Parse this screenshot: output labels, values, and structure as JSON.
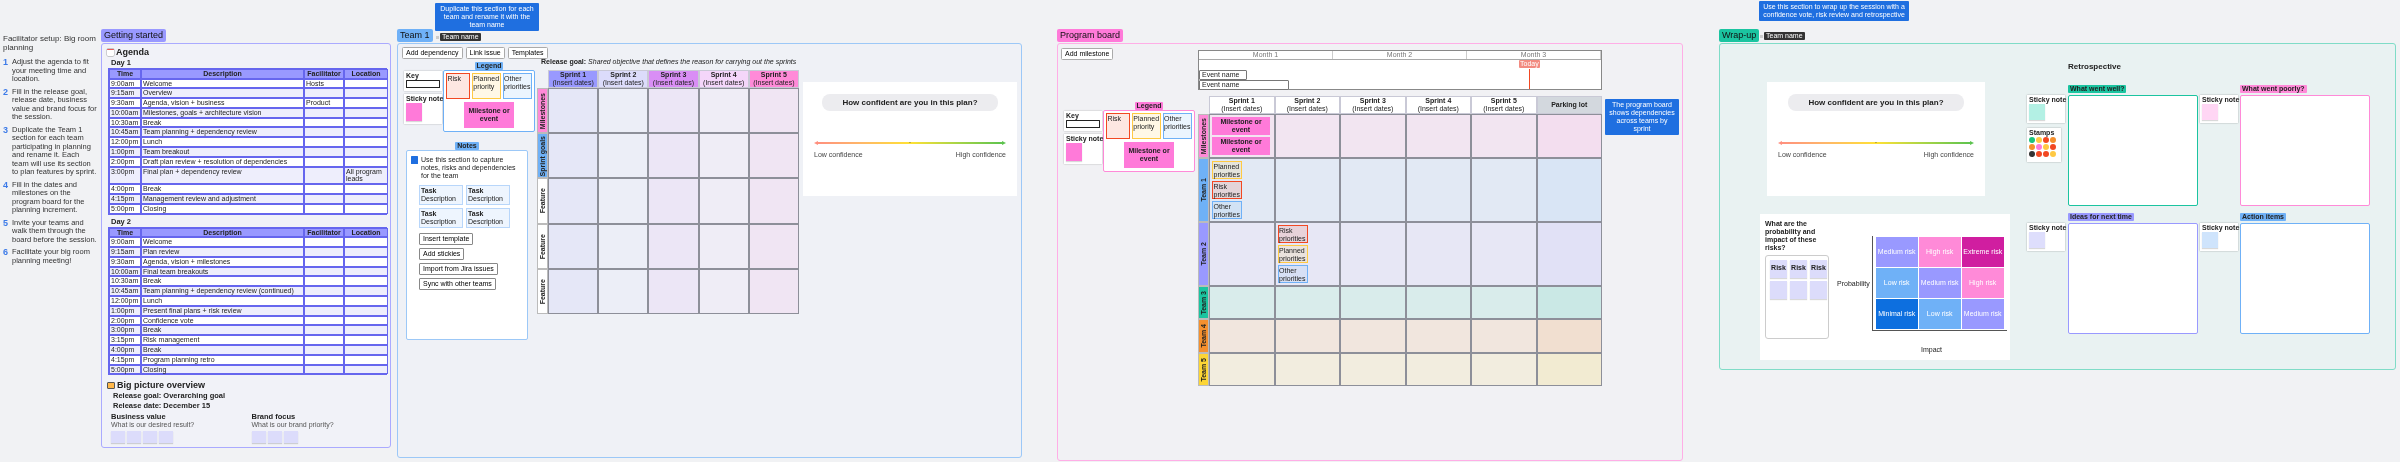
{
  "notes": {
    "title": "Facilitator setup: Big room planning",
    "steps": [
      {
        "number": "1",
        "text": "Adjust the agenda to fit your meeting time and location."
      },
      {
        "number": "2",
        "text": "Fill in the release goal, release date, business value and brand focus for the session."
      },
      {
        "number": "3",
        "text": "Duplicate the Team 1 section for each team participating in planning and rename it. Each team will use its section to plan features by sprint."
      },
      {
        "number": "4",
        "text": "Fill in the dates and milestones on the program board for the planning increment."
      },
      {
        "number": "5",
        "text": "Invite your teams and walk them through the board before the session."
      },
      {
        "number": "6",
        "text": "Facilitate your big room planning meeting!"
      }
    ]
  },
  "getting_started": {
    "title": "Getting started",
    "agenda_heading": "Agenda",
    "days": [
      {
        "label": "Day 1",
        "columns": [
          "Time",
          "Description",
          "Facilitator",
          "Location"
        ],
        "rows": [
          {
            "time": "9:00am",
            "description": "Welcome",
            "facilitator": "Hosts"
          },
          {
            "time": "9:15am",
            "description": "Overview"
          },
          {
            "time": "9:30am",
            "description": "Agenda, vision + business",
            "facilitator": "Product"
          },
          {
            "time": "10:00am",
            "description": "Milestones, goals + architecture vision"
          },
          {
            "time": "10:30am",
            "description": "Break"
          },
          {
            "time": "10:45am",
            "description": "Team planning + dependency review"
          },
          {
            "time": "12:00pm",
            "description": "Lunch"
          },
          {
            "time": "1:00pm",
            "description": "Team breakout"
          },
          {
            "time": "2:00pm",
            "description": "Draft plan review + resolution of dependencies"
          },
          {
            "time": "3:00pm",
            "description": "Final plan + dependency review",
            "location": "All program leads"
          },
          {
            "time": "4:00pm",
            "description": "Break"
          },
          {
            "time": "4:15pm",
            "description": "Management review and adjustment"
          },
          {
            "time": "5:00pm",
            "description": "Closing"
          }
        ]
      },
      {
        "label": "Day 2",
        "columns": [
          "Time",
          "Description",
          "Facilitator",
          "Location"
        ],
        "rows": [
          {
            "time": "9:00am",
            "description": "Welcome"
          },
          {
            "time": "9:15am",
            "description": "Plan review"
          },
          {
            "time": "9:30am",
            "description": "Agenda, vision + milestones"
          },
          {
            "time": "10:00am",
            "description": "Final team breakouts"
          },
          {
            "time": "10:30am",
            "description": "Break"
          },
          {
            "time": "10:45am",
            "description": "Team planning + dependency review (continued)"
          },
          {
            "time": "12:00pm",
            "description": "Lunch"
          },
          {
            "time": "1:00pm",
            "description": "Present final plans + risk review"
          },
          {
            "time": "2:00pm",
            "description": "Confidence vote"
          },
          {
            "time": "3:00pm",
            "description": "Break"
          },
          {
            "time": "3:15pm",
            "description": "Risk management"
          },
          {
            "time": "4:00pm",
            "description": "Break"
          },
          {
            "time": "4:15pm",
            "description": "Program planning retro"
          },
          {
            "time": "5:00pm",
            "description": "Closing"
          }
        ]
      }
    ],
    "overview": {
      "heading": "Big picture overview",
      "lines": [
        {
          "label": "Release goal:",
          "value": "Overarching goal"
        },
        {
          "label": "Release date:",
          "value": "December 15"
        }
      ],
      "groups": [
        {
          "title": "Business value",
          "subtitle": "What is our desired result?",
          "stickies": [
            {
              "kind": "blank"
            },
            {
              "kind": "blank"
            },
            {
              "kind": "blank"
            },
            {
              "kind": "blank"
            }
          ]
        },
        {
          "title": "Brand focus",
          "subtitle": "What is our brand priority?",
          "stickies": [
            {
              "kind": "blank"
            },
            {
              "kind": "blank"
            },
            {
              "kind": "blank"
            }
          ]
        }
      ]
    }
  },
  "team_1": {
    "title": "Team 1",
    "note": "Duplicate this section for each team and rename it with the team name",
    "name_tag": "Team name",
    "tools": [
      {
        "label": "Add dependency"
      },
      {
        "label": "Link issue"
      },
      {
        "label": "Templates"
      }
    ],
    "legend": {
      "title": "Legend",
      "key_label": "Key",
      "items": [
        {
          "kind": "dependency",
          "text": "Risk",
          "color": "#f24822"
        },
        {
          "kind": "dependency",
          "text": "Planned priority",
          "color": "#ffc943"
        },
        {
          "kind": "dependency",
          "text": "Other priorities",
          "color": "#6fb1f7"
        },
        {
          "kind": "milestone",
          "text": "Milestone or event",
          "color": "#ff7ad9"
        }
      ],
      "sticky_label": "Sticky note"
    },
    "notes_panel": {
      "title": "Notes",
      "text": "Use this section to capture notes, risks and dependencies for the team",
      "cards": [
        {
          "title": "Task",
          "subtitle": "Description"
        },
        {
          "title": "Task",
          "subtitle": "Description"
        },
        {
          "title": "Task",
          "subtitle": "Description"
        },
        {
          "title": "Task",
          "subtitle": "Description"
        }
      ],
      "actions": [
        {
          "label": "Insert template"
        },
        {
          "label": "Add stickies"
        },
        {
          "label": "Import from Jira issues"
        },
        {
          "label": "Sync with other teams"
        }
      ]
    },
    "release_goal": "**Release goal:** *Shared objective that defines the reason for carrying out the sprints*",
    "columns": [
      {
        "title": "Sprint 1",
        "dates": "(Insert dates)",
        "color": "#9999ff"
      },
      {
        "title": "Sprint 2",
        "dates": "(Insert dates)",
        "color": "#dcdcfb"
      },
      {
        "title": "Sprint 3",
        "dates": "(Insert dates)",
        "color": "#d98ef5"
      },
      {
        "title": "Sprint 4",
        "dates": "(Insert dates)",
        "color": "#f4d6fa"
      },
      {
        "title": "Sprint 5",
        "dates": "(Insert dates)",
        "color": "#ff8ad8"
      }
    ],
    "rows": [
      {
        "label": "Milestones",
        "color": "#ff8ad8"
      },
      {
        "label": "Sprint goals",
        "color": "#6fb1f7"
      },
      {
        "label": "Feature",
        "color": "#ffffff"
      },
      {
        "label": "Feature",
        "color": "#ffffff"
      },
      {
        "label": "Feature",
        "color": "#ffffff"
      }
    ],
    "confidence": {
      "question": "How confident are you in this plan?",
      "low": "Low confidence",
      "high": "High confidence",
      "level": 0.5
    }
  },
  "program_board": {
    "title": "Program board",
    "tool": "Add milestone",
    "timeline": {
      "months": [
        "Month 1",
        "Month 2",
        "Month 3"
      ],
      "marker": "Today",
      "events": [
        "Event name",
        "Event name"
      ]
    },
    "legend": {
      "title": "Legend",
      "key_label": "Key",
      "items": [
        {
          "kind": "dependency",
          "text": "Risk",
          "color": "#f24822"
        },
        {
          "kind": "dependency",
          "text": "Planned priority",
          "color": "#ffc943"
        },
        {
          "kind": "dependency",
          "text": "Other priorities",
          "color": "#6fb1f7"
        },
        {
          "kind": "milestone",
          "text": "Milestone or event",
          "color": "#ff7ad9"
        }
      ],
      "sticky_label": "Sticky note"
    },
    "columns": [
      {
        "title": "Sprint 1",
        "dates": "(Insert dates)",
        "color": "#ffffff"
      },
      {
        "title": "Sprint 2",
        "dates": "(Insert dates)",
        "color": "#ffffff"
      },
      {
        "title": "Sprint 3",
        "dates": "(Insert dates)",
        "color": "#ffffff"
      },
      {
        "title": "Sprint 4",
        "dates": "(Insert dates)",
        "color": "#ffffff"
      },
      {
        "title": "Sprint 5",
        "dates": "(Insert dates)",
        "color": "#ffffff"
      },
      {
        "title": "Parking lot",
        "color": "#d3d8de"
      }
    ],
    "rows": [
      {
        "label": "Milestones",
        "color": "#ff8ad8",
        "cells": [
          {
            "kind": "notes",
            "stickies": [
              {
                "text": "Milestone or event",
                "color": "#ff7ad9"
              },
              {
                "text": "Milestone or event",
                "color": "#ff7ad9"
              }
            ]
          },
          {
            "kind": "empty"
          },
          {
            "kind": "empty"
          },
          {
            "kind": "empty"
          },
          {
            "kind": "empty"
          },
          {
            "kind": "empty"
          }
        ]
      },
      {
        "label": "Team 1",
        "color": "#6fb1f7",
        "cells": [
          {
            "kind": "notes",
            "stickies": [
              {
                "text": "Planned priorities",
                "color": "#ffc943"
              },
              {
                "text": "Risk priorities",
                "color": "#f24822"
              },
              {
                "text": "Other priorities",
                "color": "#6fb1f7"
              }
            ]
          },
          {
            "kind": "empty"
          },
          {
            "kind": "empty"
          },
          {
            "kind": "empty"
          },
          {
            "kind": "empty"
          },
          {
            "kind": "empty"
          }
        ]
      },
      {
        "label": "Team 2",
        "color": "#9999ff",
        "cells": [
          {
            "kind": "empty"
          },
          {
            "kind": "notes",
            "stickies": [
              {
                "text": "Risk priorities",
                "color": "#f24822"
              },
              {
                "text": "Planned priorities",
                "color": "#ffc943"
              },
              {
                "text": "Other priorities",
                "color": "#6fb1f7"
              }
            ]
          },
          {
            "kind": "empty"
          },
          {
            "kind": "empty"
          },
          {
            "kind": "empty"
          },
          {
            "kind": "empty"
          }
        ]
      },
      {
        "label": "Team 3",
        "color": "#1bc4a0",
        "cells": [
          {
            "kind": "empty"
          },
          {
            "kind": "empty"
          },
          {
            "kind": "empty"
          },
          {
            "kind": "empty"
          },
          {
            "kind": "empty"
          },
          {
            "kind": "empty"
          }
        ]
      },
      {
        "label": "Team 4",
        "color": "#f5902e",
        "cells": [
          {
            "kind": "empty"
          },
          {
            "kind": "empty"
          },
          {
            "kind": "empty"
          },
          {
            "kind": "empty"
          },
          {
            "kind": "empty"
          },
          {
            "kind": "empty"
          }
        ]
      },
      {
        "label": "Team 5",
        "color": "#fcd535",
        "cells": [
          {
            "kind": "empty"
          },
          {
            "kind": "empty"
          },
          {
            "kind": "empty"
          },
          {
            "kind": "empty"
          },
          {
            "kind": "empty"
          },
          {
            "kind": "empty"
          }
        ]
      }
    ],
    "note": "The program board shows dependencies across teams by sprint"
  },
  "wrap_up": {
    "title": "Wrap-up",
    "note": "Use this section to wrap up the session with a confidence vote, risk review and retrospective",
    "name_tag": "Team name",
    "confidence": {
      "question": "How confident are you in this plan?",
      "low": "Low confidence",
      "high": "High confidence",
      "level": 0.5
    },
    "risks": {
      "question": "What are the probability and impact of these risks?",
      "stickies": [
        {
          "kind": "note",
          "text": "Risk"
        },
        {
          "kind": "note",
          "text": "Risk"
        },
        {
          "kind": "note",
          "text": "Risk"
        },
        {
          "kind": "blank"
        },
        {
          "kind": "blank"
        },
        {
          "kind": "blank"
        }
      ],
      "ylabel": "Probability",
      "xlabel": "Impact",
      "cells": [
        {
          "text": "Medium risk",
          "color": "#9999ff"
        },
        {
          "text": "High risk",
          "color": "#ff8ad8"
        },
        {
          "text": "Extreme risk",
          "color": "#d01ea0"
        },
        {
          "text": "Low risk",
          "color": "#6fb1f7"
        },
        {
          "text": "Medium risk",
          "color": "#9999ff"
        },
        {
          "text": "High risk",
          "color": "#ff8ad8"
        },
        {
          "text": "Minimal risk",
          "color": "#0d6fdf"
        },
        {
          "text": "Low risk",
          "color": "#6fb1f7"
        },
        {
          "text": "Medium risk",
          "color": "#9999ff"
        }
      ]
    },
    "retro": {
      "heading": "Retrospective",
      "stamps_label": "Stamps",
      "boxes": [
        {
          "title": "What went well?",
          "color": "#1bc4a0",
          "sticky": {
            "label": "Sticky note",
            "color": "#b3f0e4"
          }
        },
        {
          "title": "What went poorly?",
          "color": "#ff8ad8",
          "sticky": {
            "label": "Sticky note",
            "color": "#ffd6f4"
          }
        },
        {
          "title": "Ideas for next time",
          "color": "#9999ff",
          "sticky": {
            "label": "Sticky note",
            "color": "#dedefc"
          }
        },
        {
          "title": "Action items",
          "color": "#6fb1f7",
          "sticky": {
            "label": "Sticky note",
            "color": "#cfe4fc"
          }
        }
      ]
    }
  }
}
